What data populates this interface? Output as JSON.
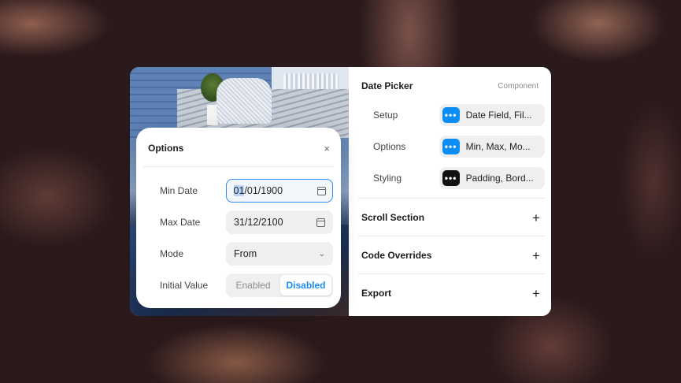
{
  "panel": {
    "title": "Date Picker",
    "subtitle": "Component",
    "properties": [
      {
        "label": "Setup",
        "value": "Date Field, Fil...",
        "icon": "dots-icon",
        "icon_color": "#0a8ef5"
      },
      {
        "label": "Options",
        "value": "Min, Max, Mo...",
        "icon": "dots-icon",
        "icon_color": "#0a8ef5"
      },
      {
        "label": "Styling",
        "value": "Padding, Bord...",
        "icon": "dots-icon",
        "icon_color": "#111111"
      }
    ],
    "sections": [
      {
        "title": "Scroll Section"
      },
      {
        "title": "Code Overrides"
      },
      {
        "title": "Export"
      }
    ]
  },
  "popover": {
    "title": "Options",
    "min_date": {
      "label": "Min Date",
      "day": "01",
      "rest": "/01/1900"
    },
    "max_date": {
      "label": "Max Date",
      "value": "31/12/2100"
    },
    "mode": {
      "label": "Mode",
      "value": "From"
    },
    "initial_value": {
      "label": "Initial Value",
      "options": [
        "Enabled",
        "Disabled"
      ],
      "selected": "Disabled"
    }
  },
  "icons": {
    "dots": "•••",
    "plus": "+",
    "close": "×",
    "chevron": "⌄"
  },
  "colors": {
    "accent": "#1a8cf0",
    "dark_icon": "#111111"
  }
}
